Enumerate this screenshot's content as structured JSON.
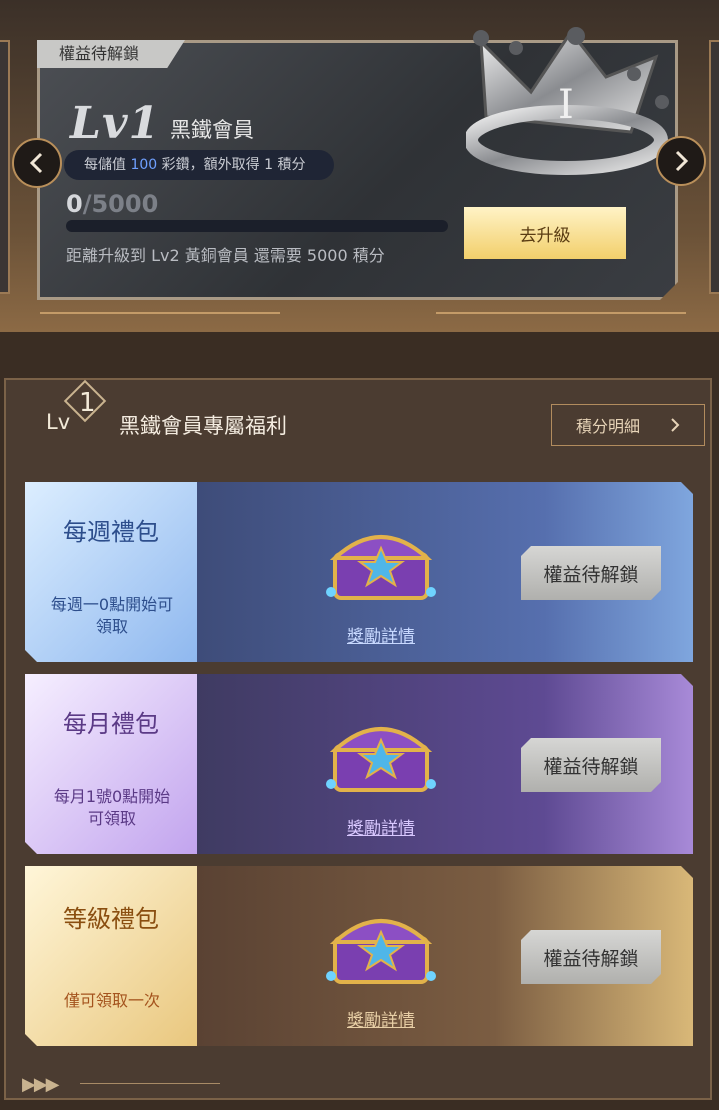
{
  "member_card": {
    "tag": "權益待解鎖",
    "level_big": "Lv1",
    "tier_name": "黑鐵會員",
    "earn_rule": {
      "prefix": "每儲值 ",
      "amount": "100",
      "suffix": " 彩鑽，額外取得 1 積分"
    },
    "points_current": "0",
    "points_target": "/5000",
    "progress": 0,
    "remaining_text": "距離升級到 Lv2 黃銅會員 還需要 5000 積分",
    "upgrade_label": "去升級"
  },
  "benefits": {
    "lv_prefix": "Lv",
    "lv_number": "1",
    "title": "黑鐵會員專屬福利",
    "detail_label": "積分明細"
  },
  "gifts": [
    {
      "title": "每週禮包",
      "note": "每週一0點開始可領取",
      "link": "獎勵詳情",
      "status": "權益待解鎖"
    },
    {
      "title": "每月禮包",
      "note": "每月1號0點開始可領取",
      "link": "獎勵詳情",
      "status": "權益待解鎖"
    },
    {
      "title": "等級禮包",
      "note": "僅可領取一次",
      "link": "獎勵詳情",
      "status": "權益待解鎖"
    }
  ],
  "colors": {
    "accent_gold": "#f2cf6b",
    "panel_bg": "#4b3c31",
    "link_blue": "#6fa0ff"
  }
}
